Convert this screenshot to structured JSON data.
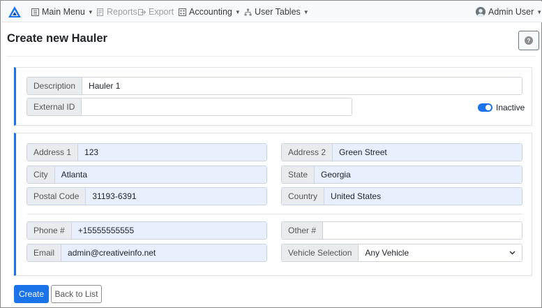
{
  "navbar": {
    "main_menu": "Main Menu",
    "reports": "Reports",
    "export": "Export",
    "accounting": "Accounting",
    "user_tables": "User Tables",
    "user": "Admin User"
  },
  "page": {
    "title": "Create new Hauler",
    "help": "?"
  },
  "general": {
    "description_label": "Description",
    "description_value": "Hauler 1",
    "external_id_label": "External ID",
    "external_id_value": "",
    "inactive_label": "Inactive"
  },
  "address": {
    "address1_label": "Address 1",
    "address1_value": "123",
    "address2_label": "Address 2",
    "address2_value": "Green Street",
    "city_label": "City",
    "city_value": "Atlanta",
    "state_label": "State",
    "state_value": "Georgia",
    "postal_label": "Postal Code",
    "postal_value": "31193-6391",
    "country_label": "Country",
    "country_value": "United States"
  },
  "contact": {
    "phone_label": "Phone #",
    "phone_value": "+15555555555",
    "other_label": "Other #",
    "other_value": "",
    "email_label": "Email",
    "email_value": "admin@creativeinfo.net",
    "vehicle_label": "Vehicle Selection",
    "vehicle_value": "Any Vehicle"
  },
  "actions": {
    "create": "Create",
    "back": "Back to List"
  },
  "colors": {
    "accent": "#1a73e8",
    "filled_bg": "#e8f0fe"
  }
}
